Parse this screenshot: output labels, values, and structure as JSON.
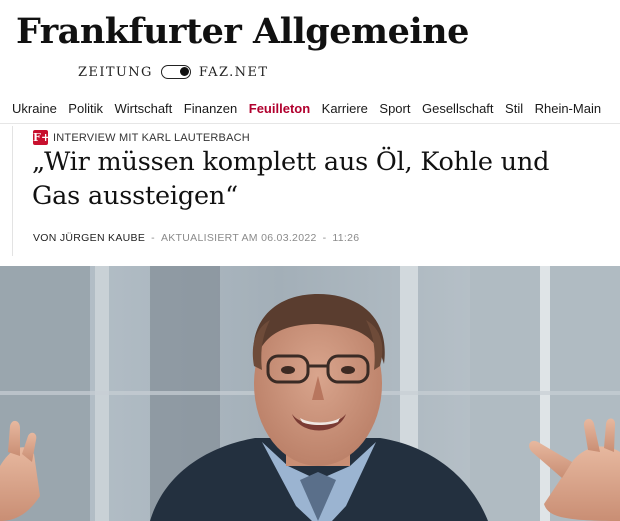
{
  "masthead": {
    "logo_text": "Frankfurter Allgemeine",
    "edition_left": "ZEITUNG",
    "edition_right": "FAZ.NET",
    "toggle_state": "right"
  },
  "nav": {
    "items": [
      {
        "label": "Ukraine"
      },
      {
        "label": "Politik"
      },
      {
        "label": "Wirtschaft"
      },
      {
        "label": "Finanzen"
      },
      {
        "label": "Feuilleton"
      },
      {
        "label": "Karriere"
      },
      {
        "label": "Sport"
      },
      {
        "label": "Gesellschaft"
      },
      {
        "label": "Stil"
      },
      {
        "label": "Rhein-Main"
      }
    ],
    "active_item": "Feuilleton",
    "accent_color": "#b1002e"
  },
  "article": {
    "kicker_icon_text": "F+",
    "kicker_icon_color": "#c8102e",
    "kicker": "INTERVIEW MIT KARL LAUTERBACH",
    "headline": "„Wir müssen komplett aus Öl, Kohle und Gas aussteigen“",
    "byline_author": "VON JÜRGEN KAUBE",
    "byline_separator": "-",
    "byline_updated": "AKTUALISIERT AM 06.03.2022",
    "byline_time": "11:26"
  },
  "hero_image": {
    "icon": "photo-icon"
  }
}
